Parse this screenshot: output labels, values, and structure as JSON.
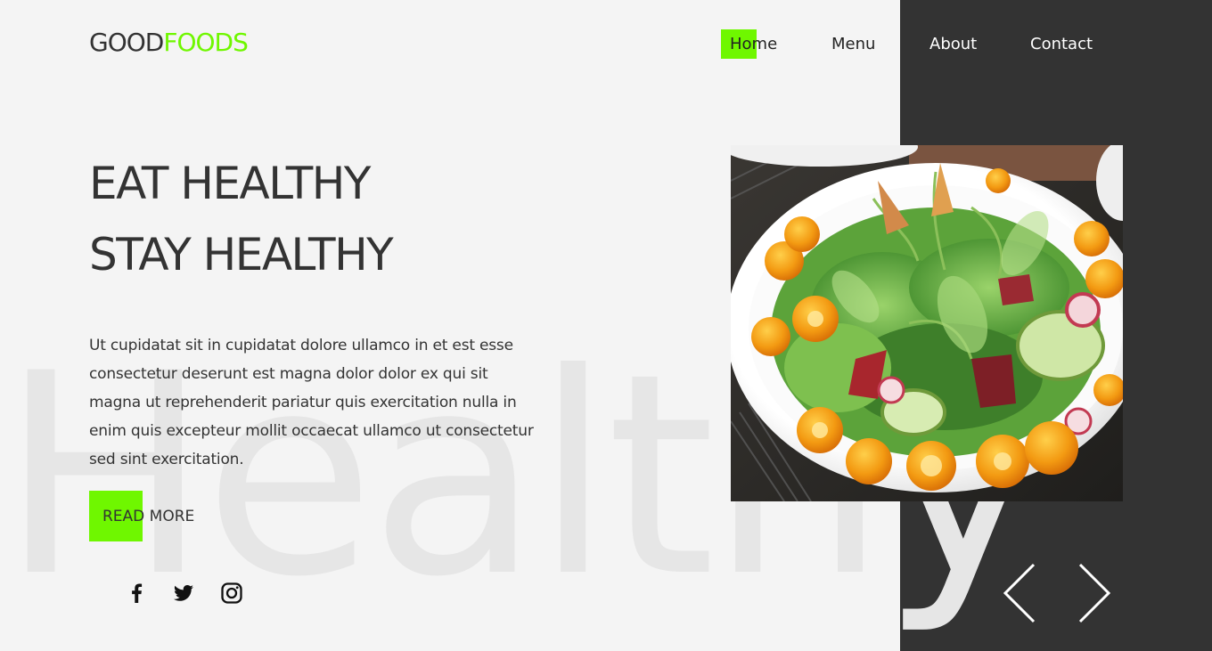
{
  "brand": {
    "logo_part1": "GOOD",
    "logo_part2": "FOODS",
    "accent_color": "#6ff700",
    "dark_color": "#333333"
  },
  "nav": {
    "items": [
      {
        "label": "Home"
      },
      {
        "label": "Menu"
      },
      {
        "label": "About"
      },
      {
        "label": "Contact"
      }
    ],
    "active": "Home"
  },
  "hero": {
    "watermark": "Healthy",
    "headline_line1": "EAT HEALTHY",
    "headline_line2": "STAY HEALTHY",
    "body": "Ut cupidatat sit in cupidatat dolore ullamco in et est esse consectetur deserunt est magna dolor dolor ex qui sit magna ut reprehenderit pariatur quis exercitation nulla in enim quis excepteur mollit occaecat ullamco ut consectetur sed sint exercitation.",
    "cta_label": "READ MORE"
  },
  "social": {
    "icons": [
      "facebook-icon",
      "twitter-icon",
      "instagram-icon"
    ]
  },
  "slider": {
    "image": "salad-bowl",
    "prev_icon": "chevron-left-icon",
    "next_icon": "chevron-right-icon"
  }
}
